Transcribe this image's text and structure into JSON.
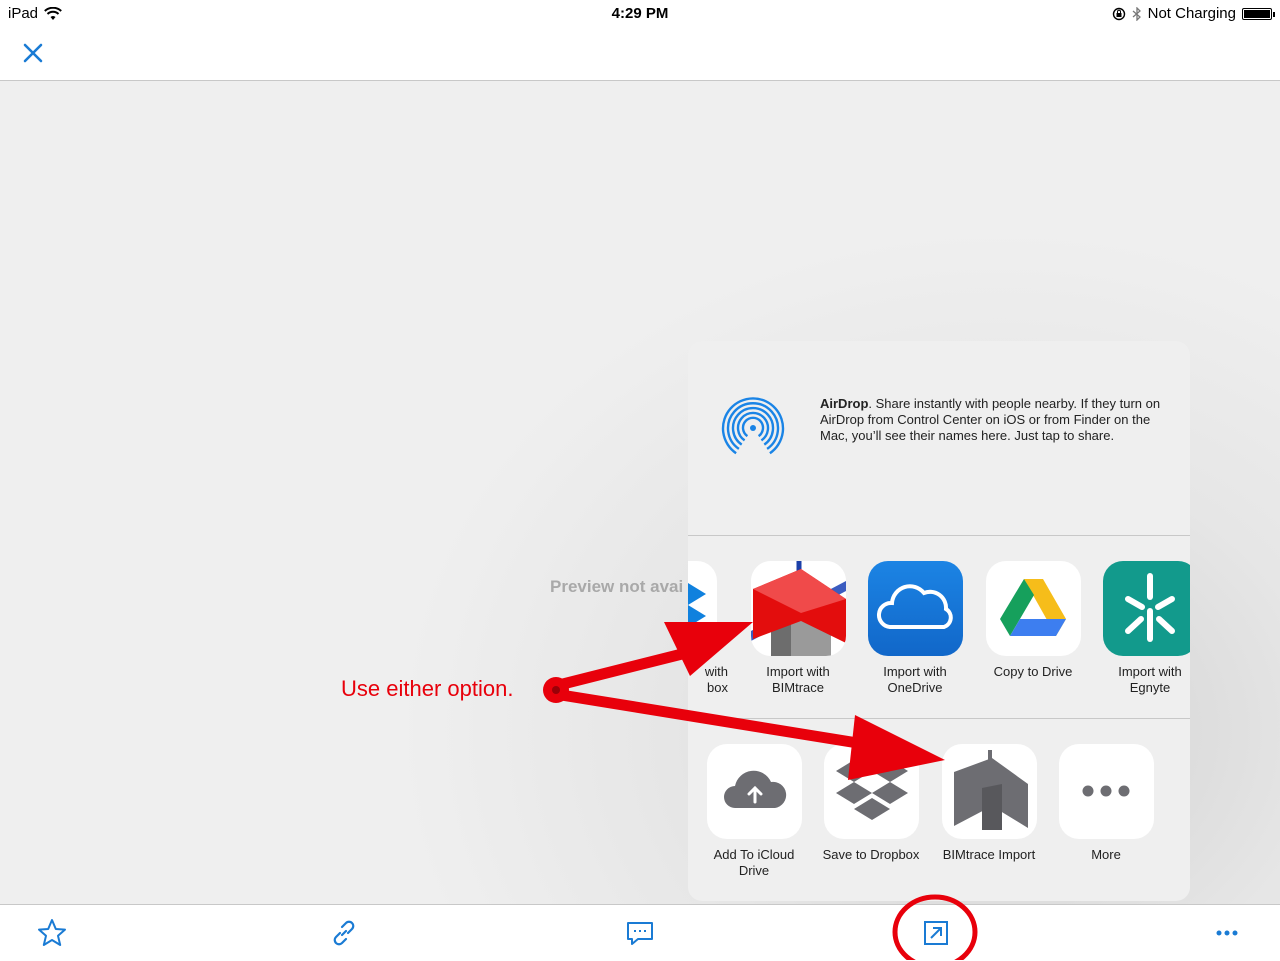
{
  "status": {
    "device": "iPad",
    "time": "4:29 PM",
    "charging": "Not Charging"
  },
  "nav": {
    "close_icon": "close-icon"
  },
  "preview": {
    "message": "Preview not avai"
  },
  "share_sheet": {
    "airdrop": {
      "title": "AirDrop",
      "description": ". Share instantly with people nearby. If they turn on AirDrop from Control Center on iOS or from Finder on the Mac, you’ll see their names here. Just tap to share."
    },
    "apps": [
      {
        "label_line1": "with",
        "label_line2": "box",
        "icon": "dropbox-icon"
      },
      {
        "label_line1": "Import with",
        "label_line2": "BIMtrace",
        "icon": "bimtrace-icon"
      },
      {
        "label_line1": "Import with",
        "label_line2": "OneDrive",
        "icon": "onedrive-icon"
      },
      {
        "label_line1": "Copy to Drive",
        "label_line2": "",
        "icon": "google-drive-icon"
      },
      {
        "label_line1": "Import with",
        "label_line2": "Egnyte",
        "icon": "egnyte-icon"
      }
    ],
    "actions": [
      {
        "label_line1": "Add To iCloud",
        "label_line2": "Drive",
        "icon": "icloud-upload-icon"
      },
      {
        "label_line1": "Save to Dropbox",
        "label_line2": "",
        "icon": "dropbox-icon"
      },
      {
        "label_line1": "BIMtrace Import",
        "label_line2": "",
        "icon": "bimtrace-import-icon"
      },
      {
        "label_line1": "More",
        "label_line2": "",
        "icon": "more-icon"
      }
    ]
  },
  "toolbar": {
    "items": [
      "star-icon",
      "link-icon",
      "comment-icon",
      "share-icon",
      "more-icon"
    ]
  },
  "annotation": {
    "text": "Use either option.",
    "color": "#e8000b"
  },
  "colors": {
    "accent": "#1a7bd4",
    "annotation": "#e8000b"
  }
}
